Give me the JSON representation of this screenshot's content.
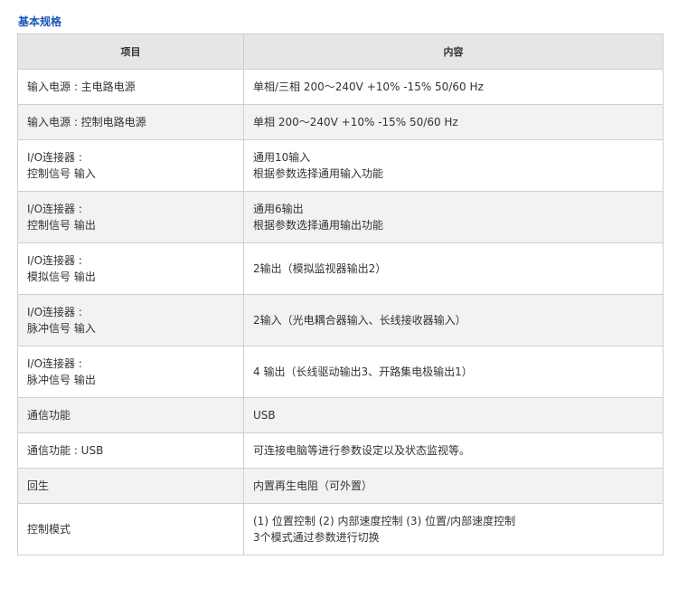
{
  "section_title": "基本规格",
  "table": {
    "headers": [
      "项目",
      "内容"
    ],
    "rows": [
      {
        "item": [
          "输入电源 : 主电路电源"
        ],
        "content": [
          "单相/三相 200～240V +10% -15% 50/60 Hz"
        ]
      },
      {
        "item": [
          "输入电源 : 控制电路电源"
        ],
        "content": [
          "单相 200～240V +10% -15% 50/60 Hz"
        ]
      },
      {
        "item": [
          "I/O连接器 :",
          "控制信号 输入"
        ],
        "content": [
          "通用10输入",
          "根据参数选择通用输入功能"
        ]
      },
      {
        "item": [
          "I/O连接器 :",
          "控制信号 输出"
        ],
        "content": [
          "通用6输出",
          "根据参数选择通用输出功能"
        ]
      },
      {
        "item": [
          "I/O连接器 :",
          "模拟信号 输出"
        ],
        "content": [
          "2输出（模拟监视器输出2）"
        ]
      },
      {
        "item": [
          "I/O连接器 :",
          "脉冲信号 输入"
        ],
        "content": [
          "2输入（光电耦合器输入、长线接收器输入）"
        ]
      },
      {
        "item": [
          "I/O连接器 :",
          "脉冲信号 输出"
        ],
        "content": [
          "4 输出（长线驱动输出3、开路集电极输出1）"
        ]
      },
      {
        "item": [
          "通信功能"
        ],
        "content": [
          "USB"
        ]
      },
      {
        "item": [
          "通信功能 : USB"
        ],
        "content": [
          "可连接电脑等进行参数设定以及状态监视等。"
        ]
      },
      {
        "item": [
          "回生"
        ],
        "content": [
          "内置再生电阻（可外置）"
        ]
      },
      {
        "item": [
          "控制模式"
        ],
        "content": [
          "(1) 位置控制   (2) 内部速度控制   (3) 位置/内部速度控制",
          "3个模式通过参数进行切换"
        ]
      }
    ]
  }
}
